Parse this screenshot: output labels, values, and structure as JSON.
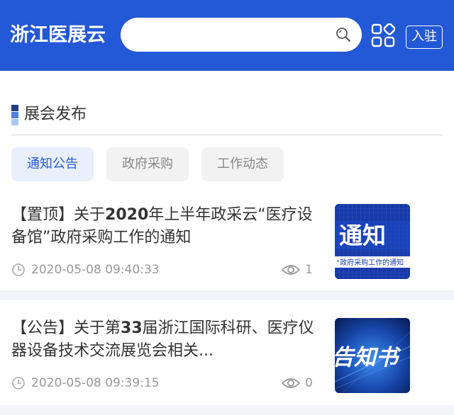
{
  "header": {
    "brand": "浙江医展云",
    "search": {
      "value": "",
      "placeholder": ""
    },
    "join_label": "入驻",
    "colors": {
      "background": "#2358d6",
      "text": "#ffffff"
    }
  },
  "section": {
    "title": "展会发布"
  },
  "tabs": [
    {
      "label": "通知公告",
      "active": true
    },
    {
      "label": "政府采购",
      "active": false
    },
    {
      "label": "工作动态",
      "active": false
    }
  ],
  "news": [
    {
      "title_prefix": "【置顶】关于",
      "title_bold": "2020",
      "title_suffix": "年上半年政采云“医疗设备馆”政府采购工作的通知",
      "time": "2020-05-08 09:40:33",
      "views": "1",
      "thumb": {
        "big_text": "通知",
        "caption": "“政府采购工作的通知"
      }
    },
    {
      "title_prefix": "【公告】关于第",
      "title_bold": "33",
      "title_suffix": "届浙江国际科研、医疗仪器设备技术交流展览会相关...",
      "time": "2020-05-08 09:39:15",
      "views": "0",
      "thumb": {
        "big_text": "告知书"
      }
    }
  ],
  "icons": {
    "search": "search-icon",
    "apps": "apps-grid-icon",
    "clock": "clock-icon",
    "eye": "eye-icon"
  }
}
